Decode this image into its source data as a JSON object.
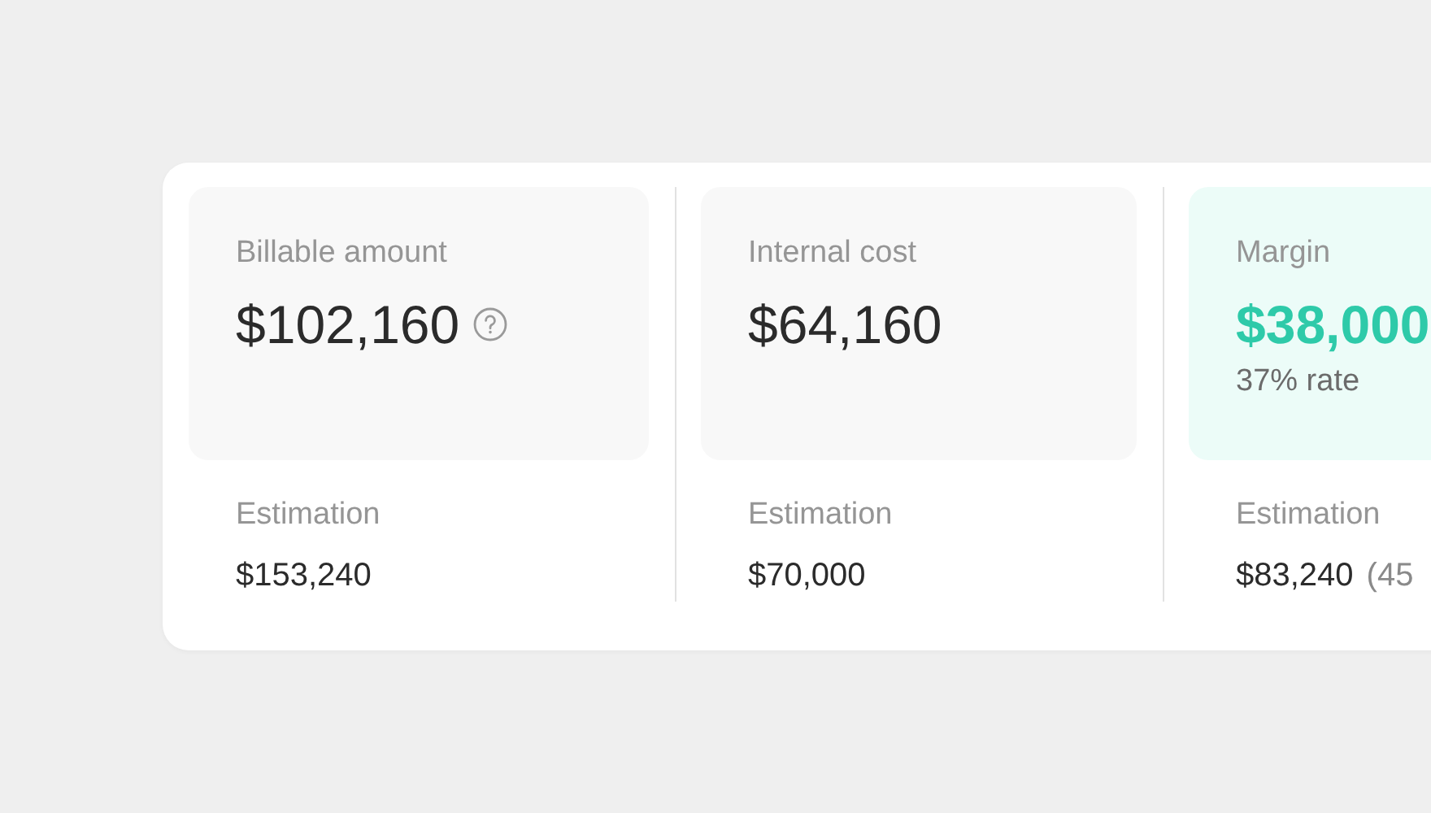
{
  "metrics": [
    {
      "label": "Billable amount",
      "value": "$102,160",
      "help_icon": true,
      "highlighted": false,
      "estimation_label": "Estimation",
      "estimation_value": "$153,240"
    },
    {
      "label": "Internal cost",
      "value": "$64,160",
      "help_icon": false,
      "highlighted": false,
      "estimation_label": "Estimation",
      "estimation_value": "$70,000"
    },
    {
      "label": "Margin",
      "value": "$38,000",
      "help_icon": false,
      "highlighted": true,
      "rate": "37% rate",
      "estimation_label": "Estimation",
      "estimation_value": "$83,240",
      "estimation_note": "(45"
    }
  ]
}
